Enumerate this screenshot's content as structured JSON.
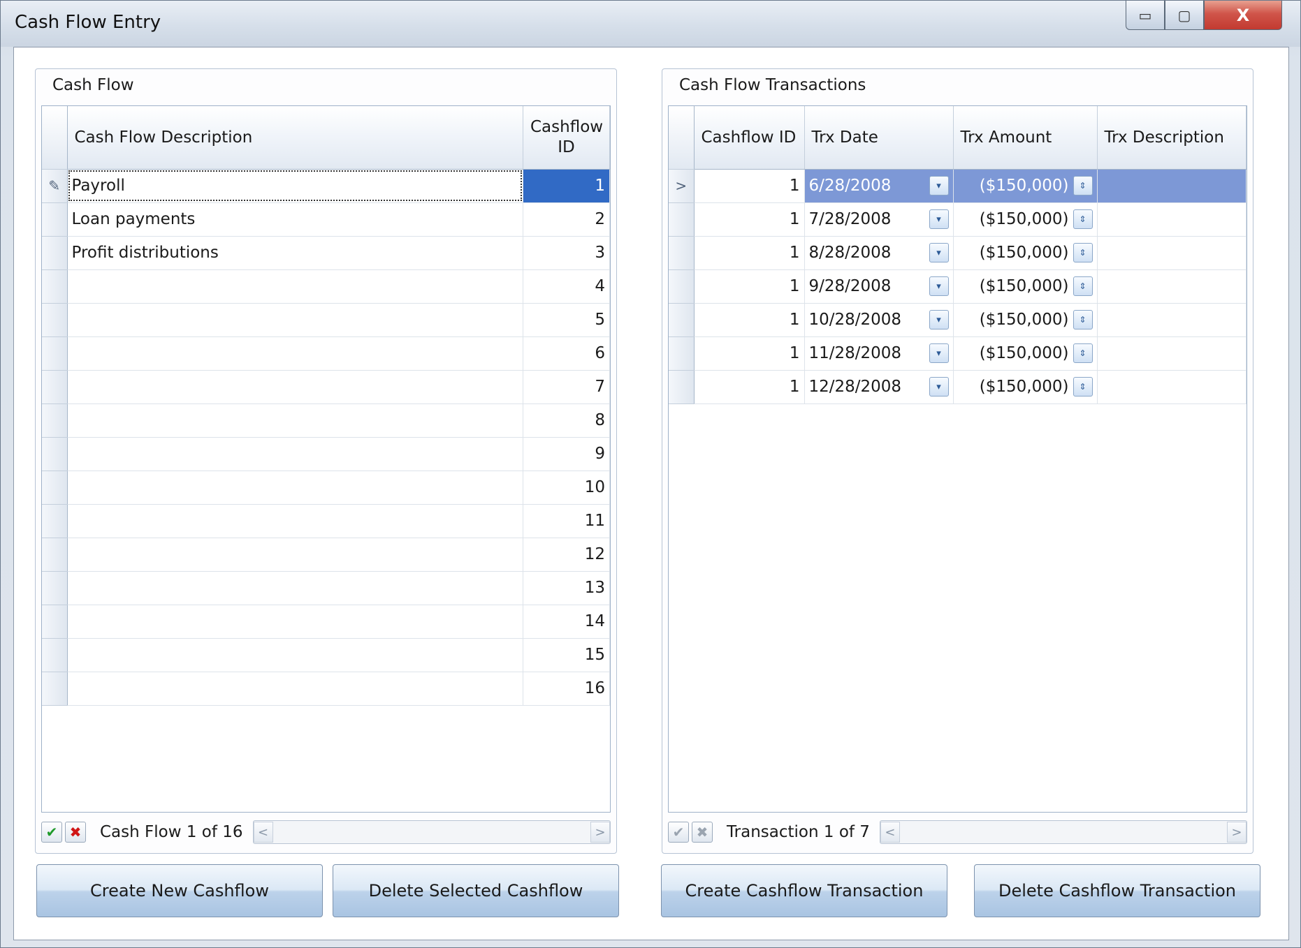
{
  "window": {
    "title": "Cash Flow Entry",
    "min_glyph": "▭",
    "max_glyph": "▢",
    "close_glyph": "X"
  },
  "cashflow_group": {
    "title": "Cash Flow",
    "columns": {
      "description": "Cash Flow Description",
      "id": "Cashflow ID"
    },
    "rows": [
      {
        "description": "Payroll",
        "id": "1"
      },
      {
        "description": "Loan payments",
        "id": "2"
      },
      {
        "description": "Profit distributions",
        "id": "3"
      },
      {
        "description": "",
        "id": "4"
      },
      {
        "description": "",
        "id": "5"
      },
      {
        "description": "",
        "id": "6"
      },
      {
        "description": "",
        "id": "7"
      },
      {
        "description": "",
        "id": "8"
      },
      {
        "description": "",
        "id": "9"
      },
      {
        "description": "",
        "id": "10"
      },
      {
        "description": "",
        "id": "11"
      },
      {
        "description": "",
        "id": "12"
      },
      {
        "description": "",
        "id": "13"
      },
      {
        "description": "",
        "id": "14"
      },
      {
        "description": "",
        "id": "15"
      },
      {
        "description": "",
        "id": "16"
      }
    ],
    "edit_row_glyph": "✎",
    "navigator_text": "Cash Flow 1 of 16",
    "ok_glyph": "✔",
    "cancel_glyph": "✖",
    "scroll_left": "<",
    "scroll_right": ">"
  },
  "transactions_group": {
    "title": "Cash Flow Transactions",
    "columns": {
      "cashflow_id": "Cashflow ID",
      "trx_date": "Trx Date",
      "trx_amount": "Trx Amount",
      "trx_description": "Trx Description"
    },
    "rows": [
      {
        "cashflow_id": "1",
        "trx_date": "6/28/2008",
        "trx_amount": "($150,000)",
        "trx_description": ""
      },
      {
        "cashflow_id": "1",
        "trx_date": "7/28/2008",
        "trx_amount": "($150,000)",
        "trx_description": ""
      },
      {
        "cashflow_id": "1",
        "trx_date": "8/28/2008",
        "trx_amount": "($150,000)",
        "trx_description": ""
      },
      {
        "cashflow_id": "1",
        "trx_date": "9/28/2008",
        "trx_amount": "($150,000)",
        "trx_description": ""
      },
      {
        "cashflow_id": "1",
        "trx_date": "10/28/2008",
        "trx_amount": "($150,000)",
        "trx_description": ""
      },
      {
        "cashflow_id": "1",
        "trx_date": "11/28/2008",
        "trx_amount": "($150,000)",
        "trx_description": ""
      },
      {
        "cashflow_id": "1",
        "trx_date": "12/28/2008",
        "trx_amount": "($150,000)",
        "trx_description": ""
      }
    ],
    "current_row_glyph": ">",
    "dropdown_glyph": "▾",
    "spin_glyph": "⇕",
    "navigator_text": "Transaction 1 of 7",
    "ok_glyph": "✔",
    "cancel_glyph": "✖",
    "scroll_left": "<",
    "scroll_right": ">"
  },
  "buttons": {
    "create_cashflow": "Create New Cashflow",
    "delete_cashflow": "Delete Selected Cashflow",
    "create_transaction": "Create Cashflow Transaction",
    "delete_transaction": "Delete Cashflow Transaction"
  },
  "colors": {
    "selection": "#316ac5",
    "selected_row": "#7d98d6",
    "ok_icon": "#1f9a2a",
    "cancel_icon": "#d01616"
  }
}
